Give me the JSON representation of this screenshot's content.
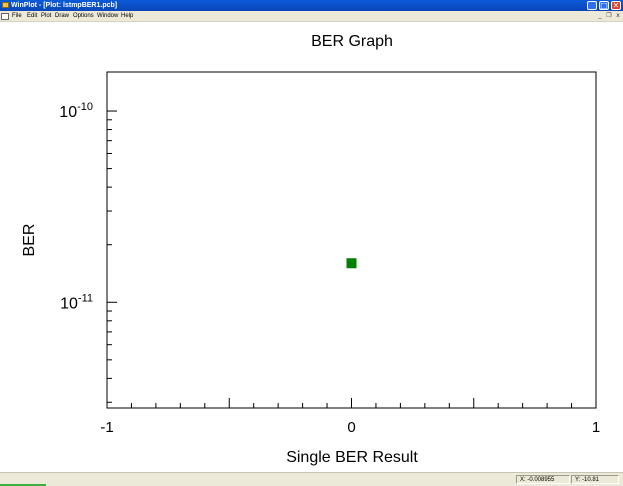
{
  "window": {
    "title": "WinPlot - [Plot: lstmpBER1.pcb]",
    "buttons": {
      "minimize": "_",
      "maximize": "□",
      "close": "✕"
    }
  },
  "menu": {
    "items": [
      "File",
      "Edit",
      "Plot",
      "Draw",
      "Options",
      "Window",
      "Help"
    ],
    "mdi_buttons": {
      "minimize": "_",
      "restore": "❐",
      "close": "x"
    }
  },
  "status": {
    "x": "X: -0.008955",
    "y": "Y: -10.81"
  },
  "chart_data": {
    "type": "scatter",
    "title": "BER Graph",
    "xlabel": "Single BER Result",
    "ylabel": "BER",
    "xlim": [
      -1,
      1
    ],
    "ylim": [
      2.8e-12,
      1.6e-10
    ],
    "y_scale": "log",
    "x_ticks": [
      "-1",
      "0",
      "1"
    ],
    "x_tick_values": [
      -1,
      0,
      1
    ],
    "y_ticks": [
      {
        "base": "10",
        "exp": "-10",
        "value": 1e-10
      },
      {
        "base": "10",
        "exp": "-11",
        "value": 1e-11
      }
    ],
    "points": [
      {
        "x": 0,
        "y": 1.6e-11
      }
    ],
    "marker": "square",
    "marker_color": "#008000",
    "grid": false
  }
}
